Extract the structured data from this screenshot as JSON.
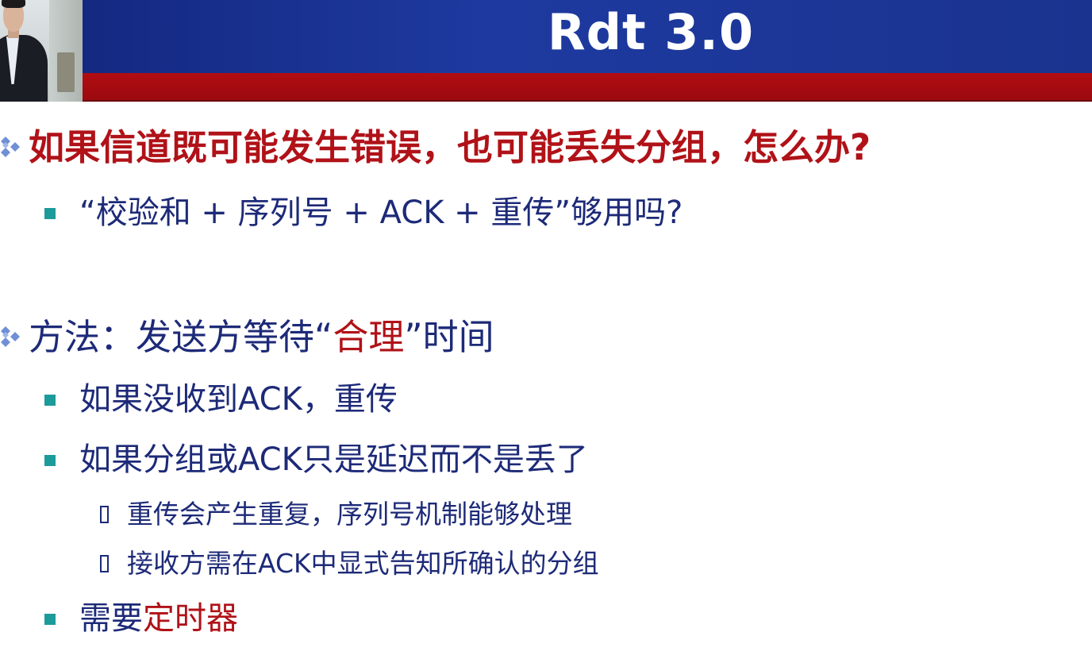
{
  "slide": {
    "title": "Rdt 3.0"
  },
  "bullets": {
    "q1": "如果信道既可能发生错误，也可能丢失分组，怎么办?",
    "q1_sub": "“校验和 + 序列号 + ACK + 重传”够用吗?",
    "method_prefix": "方法：发送方等待“",
    "method_highlight": "合理",
    "method_suffix": "”时间",
    "m1": "如果没收到ACK，重传",
    "m2": "如果分组或ACK只是延迟而不是丢了",
    "m2_a": "重传会产生重复，序列号机制能够处理",
    "m2_b": "接收方需在ACK中显式告知所确认的分组",
    "m3_prefix": "需要",
    "m3_highlight": "定时器"
  },
  "colors": {
    "header_blue": "#1e3aa0",
    "header_red": "#b10d12",
    "emphasis_red": "#b01218",
    "text_navy": "#1d2a78",
    "bullet_teal": "#1d9a9a"
  },
  "icons": {
    "level1": "diamond-cluster-icon",
    "level2": "square-bullet-icon",
    "level3": "box-bullet-icon"
  }
}
